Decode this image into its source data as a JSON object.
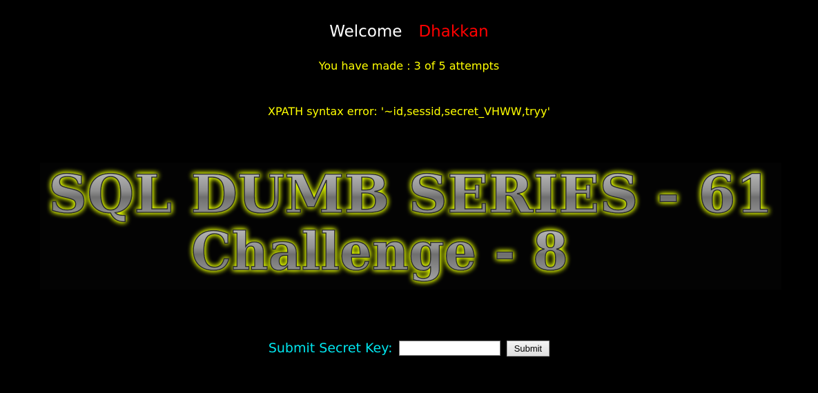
{
  "greeting": {
    "welcome": "Welcome",
    "user": "Dhakkan"
  },
  "status": {
    "attempts": "You have made : 3 of 5 attempts",
    "error": "XPATH syntax error: '~id,sessid,secret_VHWW,tryy'"
  },
  "banner": {
    "line1": "SQL DUMB SERIES - 61",
    "line2": "Challenge - 8"
  },
  "form": {
    "label": "Submit Secret Key:",
    "input_value": "",
    "submit_label": "Submit"
  },
  "colors": {
    "background": "#000000",
    "welcome": "#ffffff",
    "user": "#ff0000",
    "status": "#ffff00",
    "form_label": "#00e5ee",
    "banner_glow": "#e6ff00"
  }
}
